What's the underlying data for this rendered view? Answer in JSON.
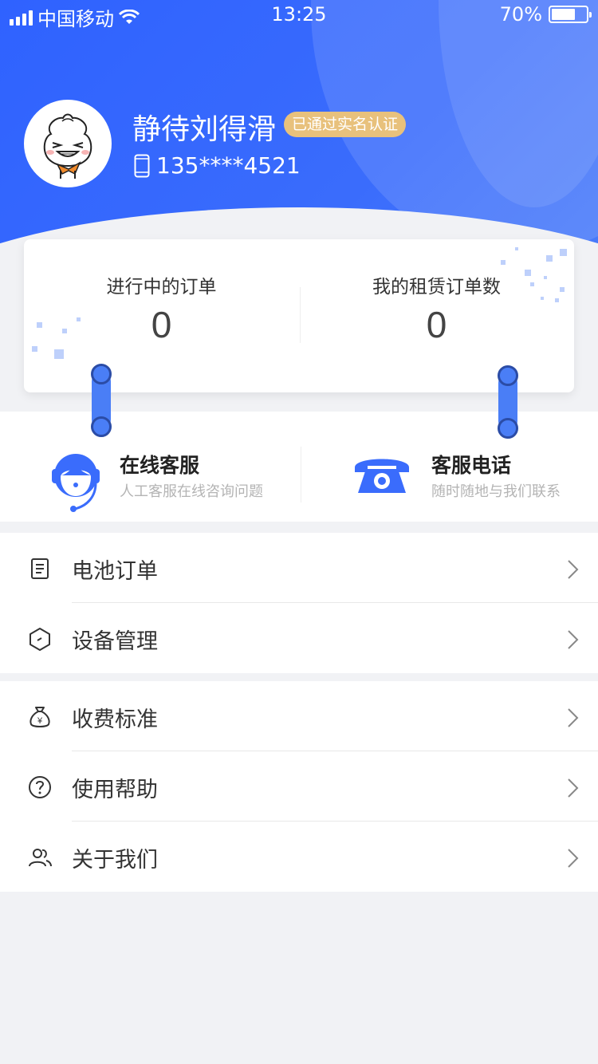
{
  "status_bar": {
    "carrier": "中国移动",
    "time": "13:25",
    "battery_percent": "70%",
    "battery_level": 0.7
  },
  "profile": {
    "username": "静待刘得滑",
    "verified_badge": "已通过实名认证",
    "phone": "135****4521"
  },
  "stats": {
    "ongoing_orders_label": "进行中的订单",
    "ongoing_orders_value": "0",
    "rental_orders_label": "我的租赁订单数",
    "rental_orders_value": "0"
  },
  "services": {
    "online_title": "在线客服",
    "online_desc": "人工客服在线咨询问题",
    "phone_title": "客服电话",
    "phone_desc": "随时随地与我们联系"
  },
  "menu": {
    "group1": [
      {
        "label": "电池订单",
        "icon": "document-icon"
      },
      {
        "label": "设备管理",
        "icon": "hexagon-icon"
      }
    ],
    "group2": [
      {
        "label": "收费标准",
        "icon": "money-bag-icon"
      },
      {
        "label": "使用帮助",
        "icon": "question-icon"
      },
      {
        "label": "关于我们",
        "icon": "users-icon"
      }
    ]
  },
  "colors": {
    "primary_blue": "#3367fd",
    "badge_gold": "#e8c17c",
    "page_bg": "#f1f2f5"
  }
}
